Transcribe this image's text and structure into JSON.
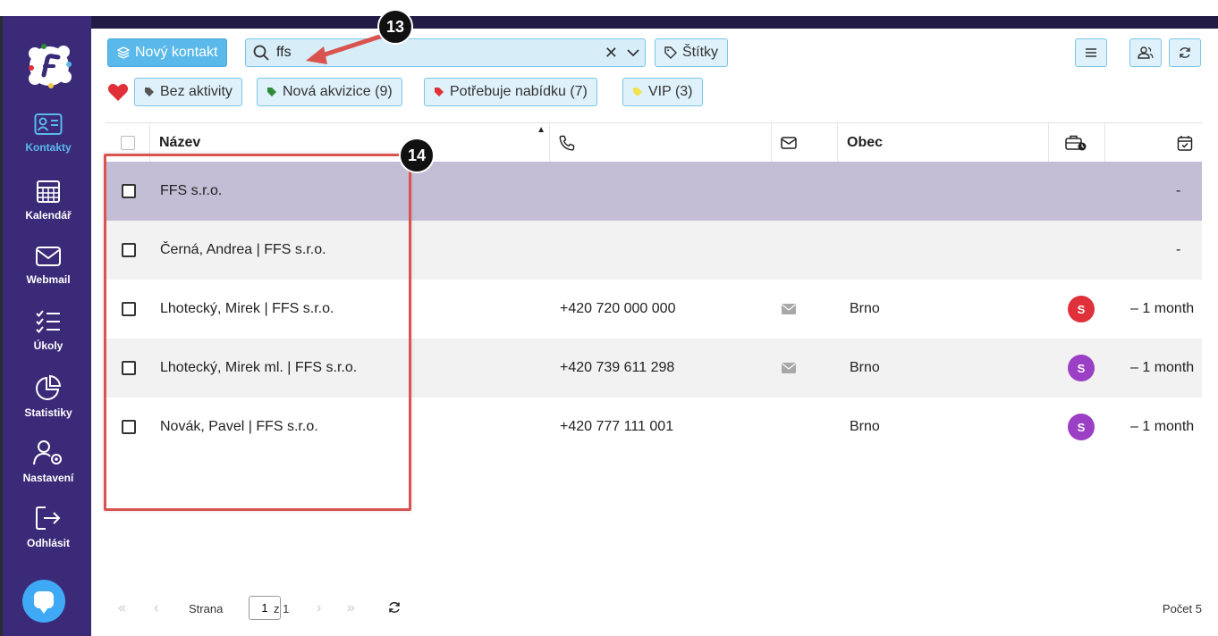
{
  "sidebar": {
    "items": [
      {
        "label": "Kontakty",
        "icon": "contact-card-icon",
        "active": true
      },
      {
        "label": "Kalendář",
        "icon": "calendar-icon"
      },
      {
        "label": "Webmail",
        "icon": "mail-icon"
      },
      {
        "label": "Úkoly",
        "icon": "task-list-icon"
      },
      {
        "label": "Statistiky",
        "icon": "pie-chart-icon"
      },
      {
        "label": "Nastavení",
        "icon": "user-settings-icon"
      },
      {
        "label": "Odhlásit",
        "icon": "logout-icon"
      }
    ]
  },
  "toolbar": {
    "new_contact_label": "Nový kontakt",
    "search_value": "ffs",
    "tags_label": "Štítky"
  },
  "filters": [
    {
      "label": "Bez aktivity",
      "color": "#555555"
    },
    {
      "label": "Nová akvizice (9)",
      "color": "#2e8b3a"
    },
    {
      "label": "Potřebuje nabídku (7)",
      "color": "#e0303a"
    },
    {
      "label": "VIP (3)",
      "color": "#f2e34a"
    }
  ],
  "table": {
    "name_header": "Název",
    "city_header": "Obec",
    "rows": [
      {
        "name": "FFS s.r.o.",
        "phone": "",
        "has_email": false,
        "city": "",
        "avatar": "",
        "avatar_color": "",
        "last": "-",
        "selected": true
      },
      {
        "name": "Černá, Andrea | FFS s.r.o.",
        "phone": "",
        "has_email": false,
        "city": "",
        "avatar": "",
        "avatar_color": "",
        "last": "-"
      },
      {
        "name": "Lhotecký, Mirek | FFS s.r.o.",
        "phone": "+420 720 000 000",
        "has_email": true,
        "city": "Brno",
        "avatar": "S",
        "avatar_color": "#e0303a",
        "last": "– 1 month"
      },
      {
        "name": "Lhotecký, Mirek ml. | FFS s.r.o.",
        "phone": "+420 739 611 298",
        "has_email": true,
        "city": "Brno",
        "avatar": "S",
        "avatar_color": "#9b3fc4",
        "last": "– 1 month"
      },
      {
        "name": "Novák, Pavel | FFS s.r.o.",
        "phone": "+420 777 111 001",
        "has_email": false,
        "city": "Brno",
        "avatar": "S",
        "avatar_color": "#9b3fc4",
        "last": "– 1 month"
      }
    ]
  },
  "footer": {
    "page_label": "Strana",
    "page_value": "1",
    "of_label": "z 1",
    "count_label": "Počet 5"
  },
  "annotations": {
    "badge_13": "13",
    "badge_14": "14"
  },
  "colors": {
    "sidebar": "#3b2a78",
    "accent": "#5ab9ea",
    "selected_row": "#c3bdd5",
    "annotation": "#d9534f"
  }
}
